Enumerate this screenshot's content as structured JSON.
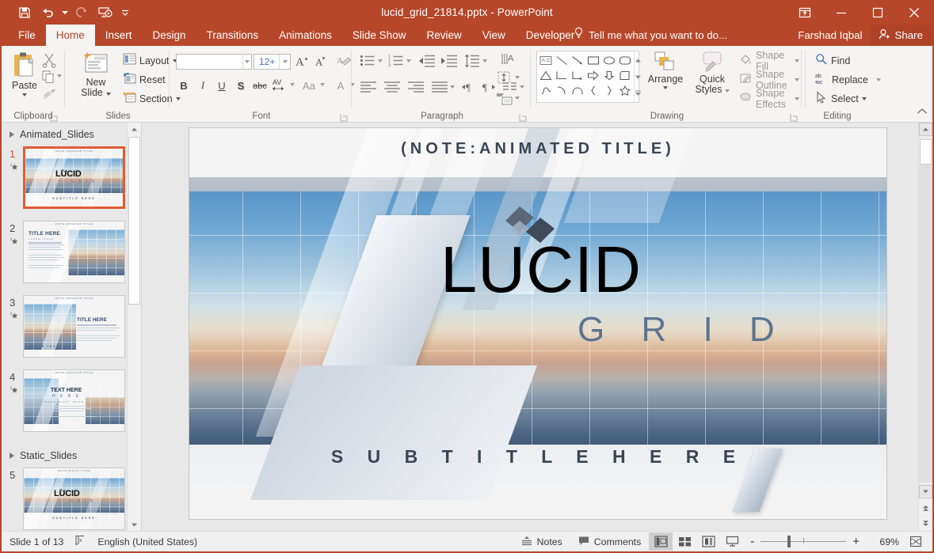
{
  "titlebar": {
    "document_title": "lucid_grid_21814.pptx - PowerPoint",
    "qat": [
      {
        "name": "save-icon",
        "label": "Save"
      },
      {
        "name": "undo-icon",
        "label": "Undo"
      },
      {
        "name": "redo-icon",
        "label": "Redo"
      },
      {
        "name": "start-presentation-icon",
        "label": "Start From Beginning"
      },
      {
        "name": "customize-qat-icon",
        "label": "Customize Quick Access Toolbar"
      }
    ],
    "window_controls": [
      {
        "name": "ribbon-display-options-icon",
        "label": "Ribbon Display Options"
      },
      {
        "name": "minimize-icon",
        "label": "Minimize"
      },
      {
        "name": "maximize-icon",
        "label": "Maximize"
      },
      {
        "name": "close-icon",
        "label": "Close"
      }
    ]
  },
  "tabs": [
    {
      "label": "File",
      "active": false
    },
    {
      "label": "Home",
      "active": true
    },
    {
      "label": "Insert",
      "active": false
    },
    {
      "label": "Design",
      "active": false
    },
    {
      "label": "Transitions",
      "active": false
    },
    {
      "label": "Animations",
      "active": false
    },
    {
      "label": "Slide Show",
      "active": false
    },
    {
      "label": "Review",
      "active": false
    },
    {
      "label": "View",
      "active": false
    },
    {
      "label": "Developer",
      "active": false
    }
  ],
  "tellme": {
    "text": "Tell me what you want to do..."
  },
  "account": {
    "user_name": "Farshad Iqbal",
    "share_label": "Share"
  },
  "ribbon": {
    "groups": [
      {
        "id": "clipboard",
        "label": "Clipboard"
      },
      {
        "id": "slides",
        "label": "Slides"
      },
      {
        "id": "font",
        "label": "Font"
      },
      {
        "id": "paragraph",
        "label": "Paragraph"
      },
      {
        "id": "drawing",
        "label": "Drawing"
      },
      {
        "id": "editing",
        "label": "Editing"
      }
    ],
    "clipboard": {
      "paste_label": "Paste",
      "cut_label": "Cut",
      "copy_label": "Copy",
      "format_painter_label": "Format Painter"
    },
    "slides": {
      "new_slide_label": "New\nSlide",
      "new_slide_line1": "New",
      "new_slide_line2": "Slide",
      "layout_label": "Layout",
      "reset_label": "Reset",
      "section_label": "Section"
    },
    "font": {
      "font_name_value": "",
      "font_name_placeholder": "",
      "font_size_value": "12+",
      "grow_font_label": "A",
      "shrink_font_label": "A",
      "clear_formatting_label": "Clear All Formatting",
      "bold_label": "B",
      "italic_label": "I",
      "underline_label": "U",
      "shadow_label": "S",
      "strikethrough_label": "abc",
      "char_spacing_label": "AV",
      "change_case_label": "Aa",
      "font_color_label": "A"
    },
    "paragraph": {
      "bullets_label": "Bullets",
      "numbering_label": "Numbering",
      "decrease_indent_label": "Decrease List Level",
      "increase_indent_label": "Increase List Level",
      "line_spacing_label": "Line Spacing",
      "text_direction_label": "Text Direction",
      "align_text_label": "Align Text",
      "convert_smartart_label": "Convert to SmartArt",
      "align_left_label": "Align Left",
      "center_label": "Center",
      "align_right_label": "Align Right",
      "justify_label": "Justify",
      "ltr_label": "Left-to-Right",
      "rtl_label": "Right-to-Left",
      "columns_label": "Columns"
    },
    "drawing": {
      "arrange_label": "Arrange",
      "quick_styles_line1": "Quick",
      "quick_styles_line2": "Styles",
      "shape_fill_label": "Shape Fill",
      "shape_outline_label": "Shape Outline",
      "shape_effects_label": "Shape Effects"
    },
    "editing": {
      "find_label": "Find",
      "replace_label": "Replace",
      "select_label": "Select",
      "collapse_ribbon_label": "Collapse the Ribbon"
    }
  },
  "thumbnails": {
    "sections": [
      {
        "name": "Animated_Slides",
        "slides": [
          {
            "number": "1",
            "animated": true,
            "selected": true,
            "title": "LUCID",
            "sub": "G R I D",
            "foot": "SUBTITLE HERE",
            "type": "cover"
          },
          {
            "number": "2",
            "animated": true,
            "selected": false,
            "title": "TITLE HERE",
            "sub": "LOREM IPSUM",
            "foot": "OTHER TEXT",
            "type": "text-left"
          },
          {
            "number": "3",
            "animated": true,
            "selected": false,
            "title": "TITLE HERE",
            "sub": "",
            "foot": "OTHER TEXT",
            "type": "text-right"
          },
          {
            "number": "4",
            "animated": true,
            "selected": false,
            "title": "TEXT HERE",
            "sub": "MORE COPY HERE",
            "foot": "",
            "type": "text-center"
          }
        ]
      },
      {
        "name": "Static_Slides",
        "slides": [
          {
            "number": "5",
            "animated": false,
            "selected": false,
            "title": "LUCID",
            "sub": "G R I D",
            "foot": "SUBTITLE HERE",
            "type": "cover"
          }
        ]
      }
    ]
  },
  "slide": {
    "note_title": "(NOTE:ANIMATED TITLE)",
    "brand_main": "LUCID",
    "brand_sub": "G R I D",
    "subtitle": "S U B T I T L E   H E R E"
  },
  "statusbar": {
    "slide_counter": "Slide 1 of 13",
    "spellcheck_icon": "proofing-icon",
    "language": "English (United States)",
    "notes_label": "Notes",
    "comments_label": "Comments",
    "views": [
      {
        "name": "normal-view-button",
        "active": true
      },
      {
        "name": "slide-sorter-view-button",
        "active": false
      },
      {
        "name": "reading-view-button",
        "active": false
      },
      {
        "name": "slide-show-button",
        "active": false
      }
    ],
    "zoom_out_label": "-",
    "zoom_in_label": "+",
    "zoom_value": "69%",
    "fit_slide_label": "Fit slide to current window"
  },
  "colors": {
    "accent": "#b7472a",
    "ribbon_bg": "#f5f4f2",
    "selection": "#e05c33",
    "brand_dark": "#3b4656",
    "brand_grid": "#5d7490"
  }
}
